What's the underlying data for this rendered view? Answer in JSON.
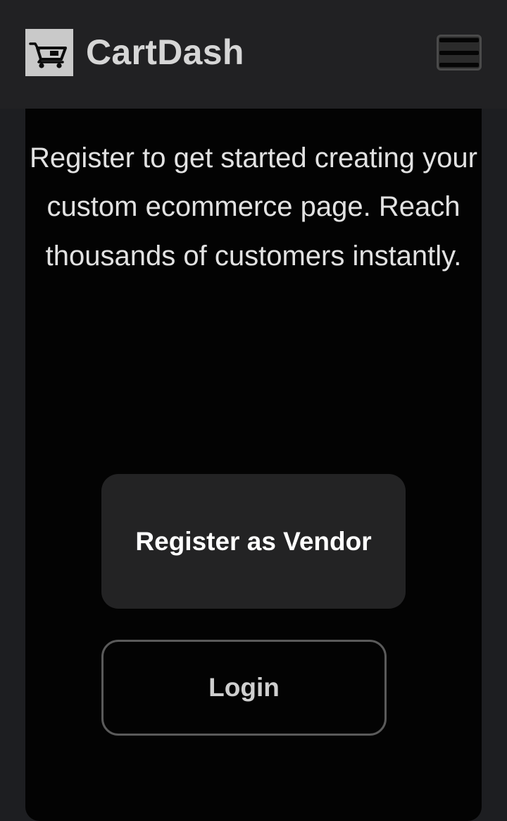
{
  "header": {
    "brand": "CartDash",
    "logo_icon": "shopping-cart-icon",
    "menu_icon": "hamburger-menu-icon"
  },
  "main": {
    "intro_text": "Register to get started creating your custom ecommerce page. Reach thousands of customers instantly.",
    "register_button_label": "Register as Vendor",
    "login_button_label": "Login"
  },
  "colors": {
    "page_background": "#1d1e21",
    "header_background": "#212123",
    "card_background": "#030303",
    "primary_button": "#232324",
    "outline_button_border": "#5a5a5a",
    "text_light": "#e2e2e2"
  }
}
